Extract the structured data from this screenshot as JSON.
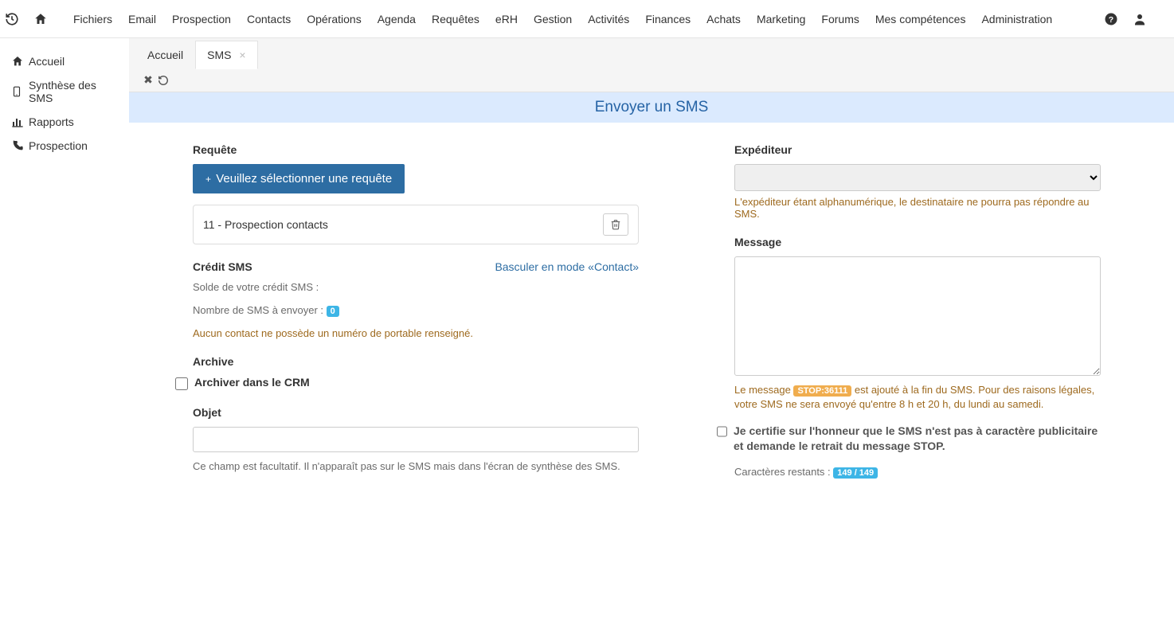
{
  "topnav": {
    "items": [
      "Fichiers",
      "Email",
      "Prospection",
      "Contacts",
      "Opérations",
      "Agenda",
      "Requêtes",
      "eRH",
      "Gestion",
      "Activités",
      "Finances",
      "Achats",
      "Marketing",
      "Forums",
      "Mes compétences",
      "Administration"
    ]
  },
  "sidebar": {
    "items": [
      {
        "label": "Accueil"
      },
      {
        "label": "Synthèse des SMS"
      },
      {
        "label": "Rapports"
      },
      {
        "label": "Prospection"
      }
    ]
  },
  "tabs": {
    "items": [
      {
        "label": "Accueil",
        "active": false,
        "closable": false
      },
      {
        "label": "SMS",
        "active": true,
        "closable": true
      }
    ]
  },
  "page": {
    "title": "Envoyer un SMS"
  },
  "left": {
    "requete_label": "Requête",
    "select_query_btn": "Veuillez sélectionner une requête",
    "query_item": "11 - Prospection contacts",
    "credit_heading": "Crédit SMS",
    "contact_mode_link": "Basculer en mode «Contact»",
    "balance_label": "Solde de votre crédit SMS :",
    "count_label": "Nombre de SMS à envoyer :",
    "count_value": "0",
    "no_mobile_warning": "Aucun contact ne possède un numéro de portable renseigné.",
    "archive_heading": "Archive",
    "archive_checkbox_label": "Archiver dans le CRM",
    "objet_label": "Objet",
    "objet_value": "",
    "objet_help": "Ce champ est facultatif. Il n'apparaît pas sur le SMS mais dans l'écran de synthèse des SMS."
  },
  "right": {
    "expediteur_label": "Expéditeur",
    "expediteur_value": "",
    "expediteur_help": "L'expéditeur étant alphanumérique, le destinataire ne pourra pas répondre au SMS.",
    "message_label": "Message",
    "message_value": "",
    "stop_help_prefix": "Le message",
    "stop_badge": "STOP:36111",
    "stop_help_suffix": "est ajouté à la fin du SMS. Pour des raisons légales, votre SMS ne sera envoyé qu'entre 8 h et 20 h, du lundi au samedi.",
    "certify_label": "Je certifie sur l'honneur que le SMS n'est pas à caractère publicitaire et demande le retrait du message STOP.",
    "chars_label": "Caractères restants :",
    "chars_value": "149 / 149"
  }
}
